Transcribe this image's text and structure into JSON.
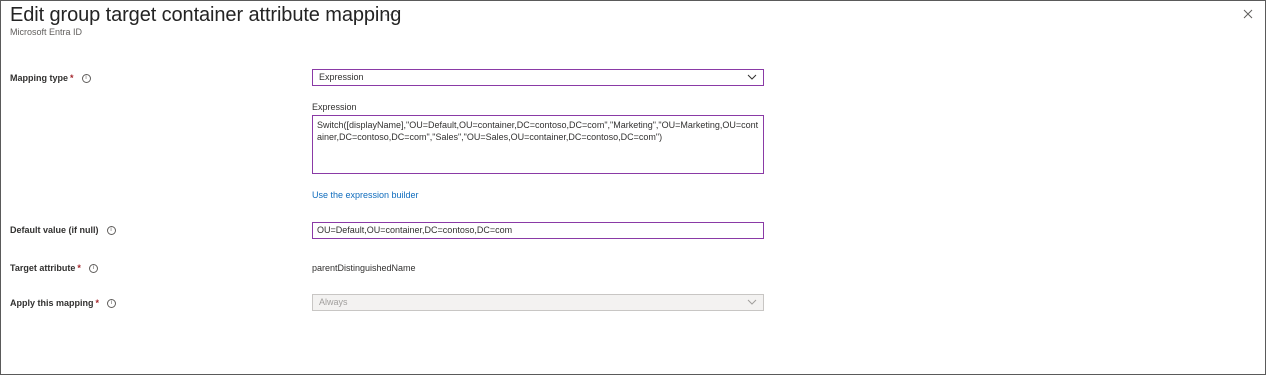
{
  "header": {
    "title": "Edit group target container attribute mapping",
    "more_label": "···",
    "subtitle": "Microsoft Entra ID"
  },
  "form": {
    "mapping_type": {
      "label": "Mapping type",
      "required_mark": "*",
      "value": "Expression"
    },
    "expression": {
      "label": "Expression",
      "value": "Switch([displayName],\"OU=Default,OU=container,DC=contoso,DC=com\",\"Marketing\",\"OU=Marketing,OU=container,DC=contoso,DC=com\",\"Sales\",\"OU=Sales,OU=container,DC=contoso,DC=com\")",
      "builder_link": "Use the expression builder"
    },
    "default_value": {
      "label": "Default value (if null)",
      "value": "OU=Default,OU=container,DC=contoso,DC=com"
    },
    "target_attribute": {
      "label": "Target attribute",
      "required_mark": "*",
      "value": "parentDistinguishedName"
    },
    "apply_mapping": {
      "label": "Apply this mapping",
      "required_mark": "*",
      "value": "Always"
    }
  },
  "icons": {
    "info": "i",
    "close": "close-icon",
    "chevron": "chevron-down-icon"
  },
  "colors": {
    "focus_border": "#8a3aa6",
    "required": "#a4262c",
    "link": "#0f6cbd"
  }
}
